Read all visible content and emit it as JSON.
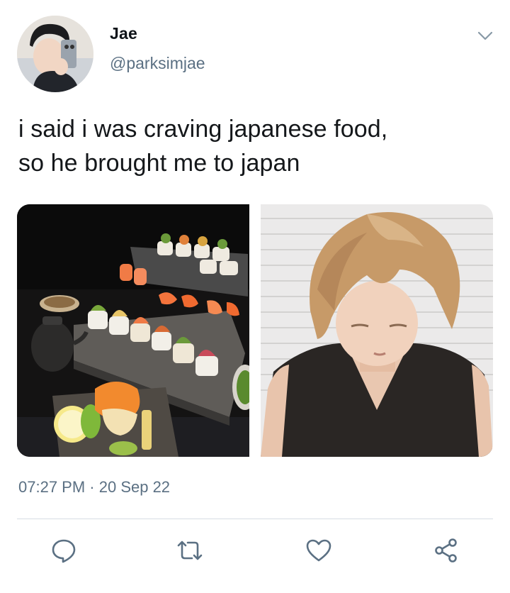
{
  "tweet": {
    "author": {
      "display_name": "Jae",
      "handle": "@parksimjae"
    },
    "text_lines": [
      "i said i was craving japanese food,",
      "so he brought me to japan"
    ],
    "timestamp": {
      "time": "07:27 PM",
      "separator": " · ",
      "date": "20 Sep 22"
    },
    "media": [
      {
        "subject": "sushi platter on dark table"
      },
      {
        "subject": "blond person in black knit top"
      }
    ],
    "actions": [
      {
        "icon": "reply-icon"
      },
      {
        "icon": "retweet-icon"
      },
      {
        "icon": "like-icon"
      },
      {
        "icon": "share-icon"
      }
    ],
    "colors": {
      "secondary_text": "#5b7083",
      "primary_text": "#14171a",
      "icon": "#5b7083",
      "divider": "#d6dde3"
    }
  }
}
